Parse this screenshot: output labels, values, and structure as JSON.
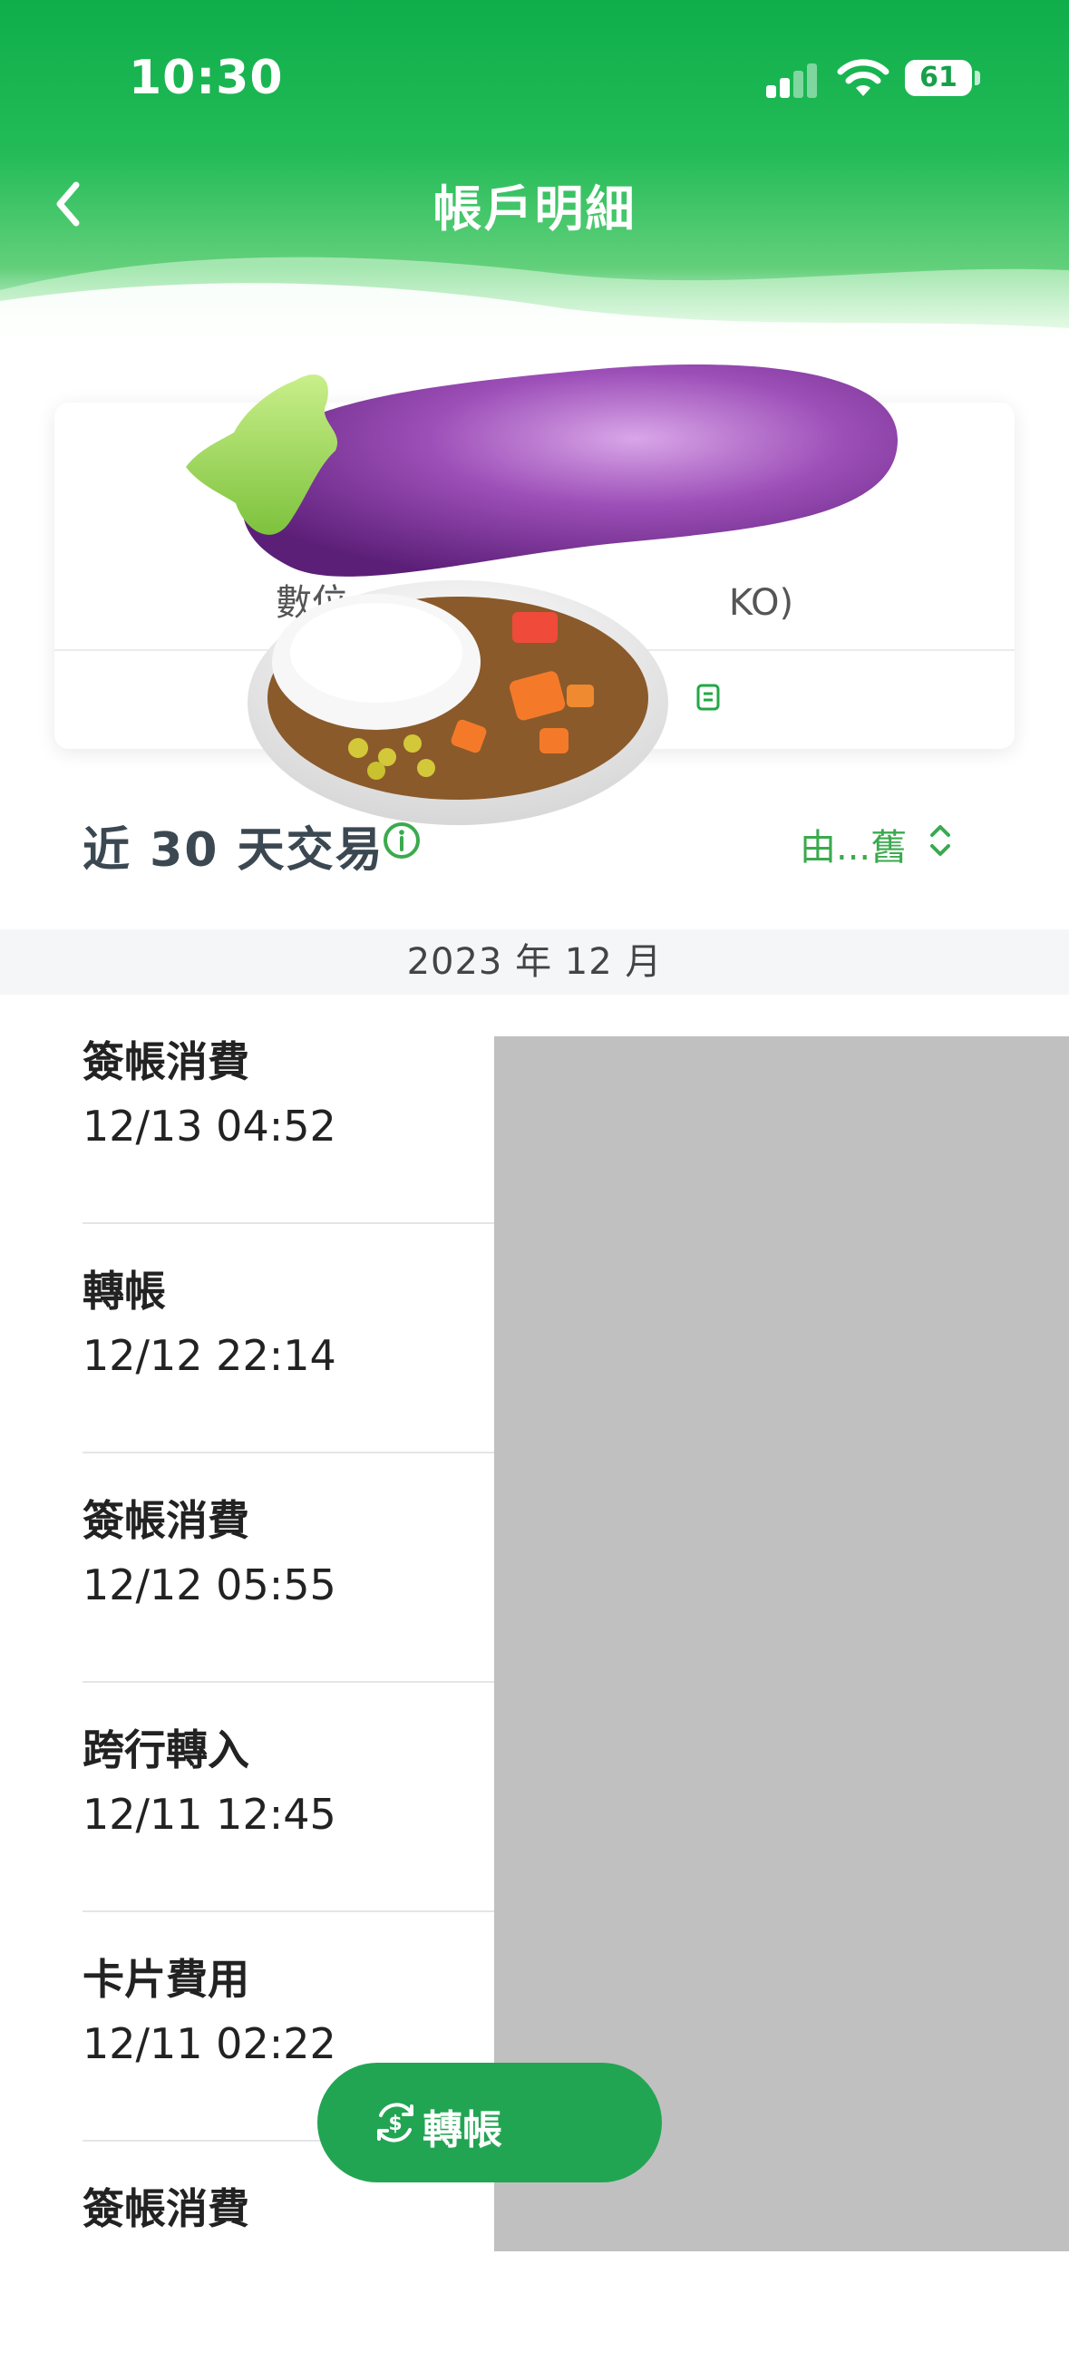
{
  "status_bar": {
    "time": "10:30",
    "battery": "61"
  },
  "header": {
    "title": "帳戶明細"
  },
  "account_card": {
    "account_label": "數位",
    "account_suffix": "KO)"
  },
  "transactions_section": {
    "title": "近 30 天交易",
    "sort_label": "由...舊"
  },
  "month_header": "2023 年 12 月",
  "transactions": [
    {
      "type": "簽帳消費",
      "time": "12/13 04:52"
    },
    {
      "type": "轉帳",
      "time": "12/12 22:14"
    },
    {
      "type": "簽帳消費",
      "time": "12/12 05:55"
    },
    {
      "type": "跨行轉入",
      "time": "12/11 12:45"
    },
    {
      "type": "卡片費用",
      "time": "12/11 02:22"
    },
    {
      "type": "簽帳消費",
      "time": ""
    }
  ],
  "fab": {
    "label": "轉帳"
  },
  "colors": {
    "brand_green": "#22a553",
    "header_green": "#0fae4b",
    "redaction_gray": "#c0c0c0"
  },
  "icons": [
    "back-chevron-icon",
    "signal-icon",
    "wifi-icon",
    "battery-icon",
    "info-icon",
    "sort-icon",
    "transfer-icon"
  ]
}
